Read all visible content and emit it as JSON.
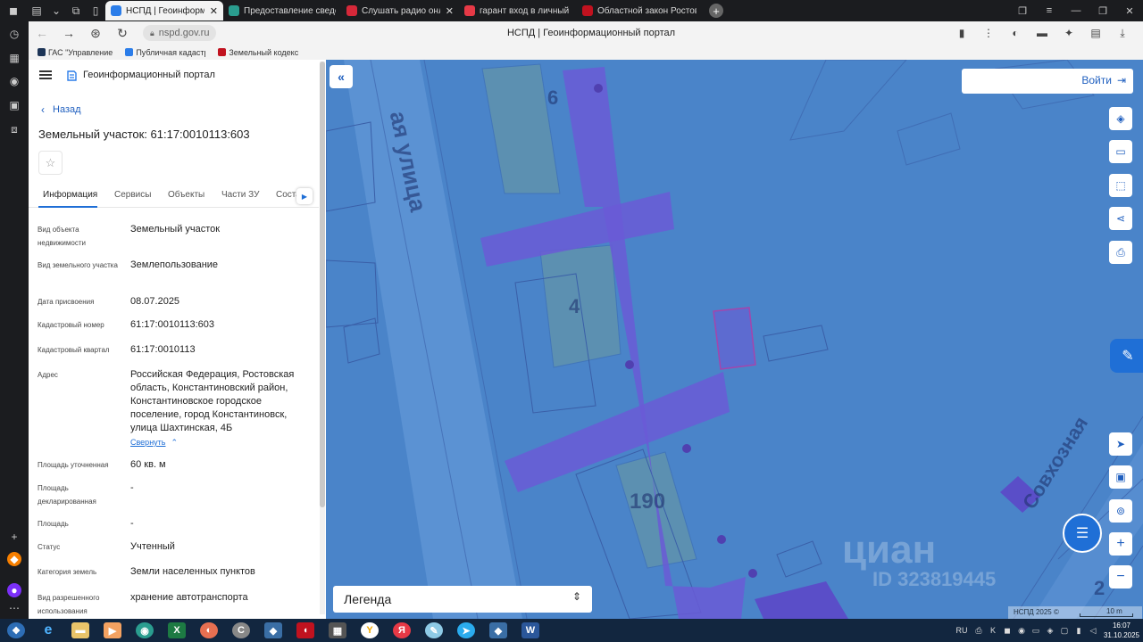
{
  "browser": {
    "tabs": [
      {
        "label": "НСПД | Геоинформационный портал",
        "active": true,
        "color": "#2b7de9"
      },
      {
        "label": "Предоставление сведений",
        "active": false,
        "color": "#2a9d8f"
      },
      {
        "label": "Слушать радио онлайн",
        "active": false,
        "color": "#d62839"
      },
      {
        "label": "гарант вход в личный кабинет",
        "active": false,
        "color": "#e63946"
      },
      {
        "label": "Областной закон Ростовской",
        "active": false,
        "color": "#c1121f"
      }
    ],
    "url": "nspd.gov.ru",
    "page_title": "НСПД | Геоинформационный портал",
    "bookmarks": [
      {
        "label": "ГАС \"Управление",
        "color": "#1d3557"
      },
      {
        "label": "Публичная кадастровая",
        "color": "#2b7de9"
      },
      {
        "label": "Земельный кодекс",
        "color": "#c1121f"
      }
    ]
  },
  "panel": {
    "portal_title": "Геоинформационный портал",
    "back_label": "Назад",
    "object_title": "Земельный участок: 61:17:0010113:603",
    "tabs": [
      "Информация",
      "Сервисы",
      "Объекты",
      "Части ЗУ",
      "Состав ЗУ"
    ],
    "fields": [
      {
        "label": "Вид объекта недвижимости",
        "value": "Земельный участок"
      },
      {
        "label": "Вид земельного участка",
        "value": "Землепользование"
      },
      {
        "label": "Дата присвоения",
        "value": "08.07.2025"
      },
      {
        "label": "Кадастровый номер",
        "value": "61:17:0010113:603"
      },
      {
        "label": "Кадастровый квартал",
        "value": "61:17:0010113"
      },
      {
        "label": "Адрес",
        "value": "Российская Федерация, Ростовская область, Константиновский район, Константиновское городское поселение, город Константиновск, улица Шахтинская, 4Б"
      },
      {
        "label": "Площадь уточненная",
        "value": "60 кв. м"
      },
      {
        "label": "Площадь декларированная",
        "value": "-"
      },
      {
        "label": "Площадь",
        "value": "-"
      },
      {
        "label": "Статус",
        "value": "Учтенный"
      },
      {
        "label": "Категория земель",
        "value": "Земли населенных пунктов"
      },
      {
        "label": "Вид разрешенного использования",
        "value": "хранение автотранспорта"
      }
    ],
    "collapse_label": "Свернуть"
  },
  "map": {
    "login_label": "Войти",
    "legend_label": "Легенда",
    "attribution": "НСПД 2025 ©",
    "scale_label": "10 m",
    "street_label": "ая улица",
    "street_label_2": "Совхозная",
    "building_numbers": [
      "6",
      "4",
      "190",
      "2"
    ],
    "watermark": "циан",
    "watermark_id": "ID 323819445"
  },
  "taskbar": {
    "lang": "RU",
    "time": "16:07",
    "date": "31.10.2025"
  }
}
